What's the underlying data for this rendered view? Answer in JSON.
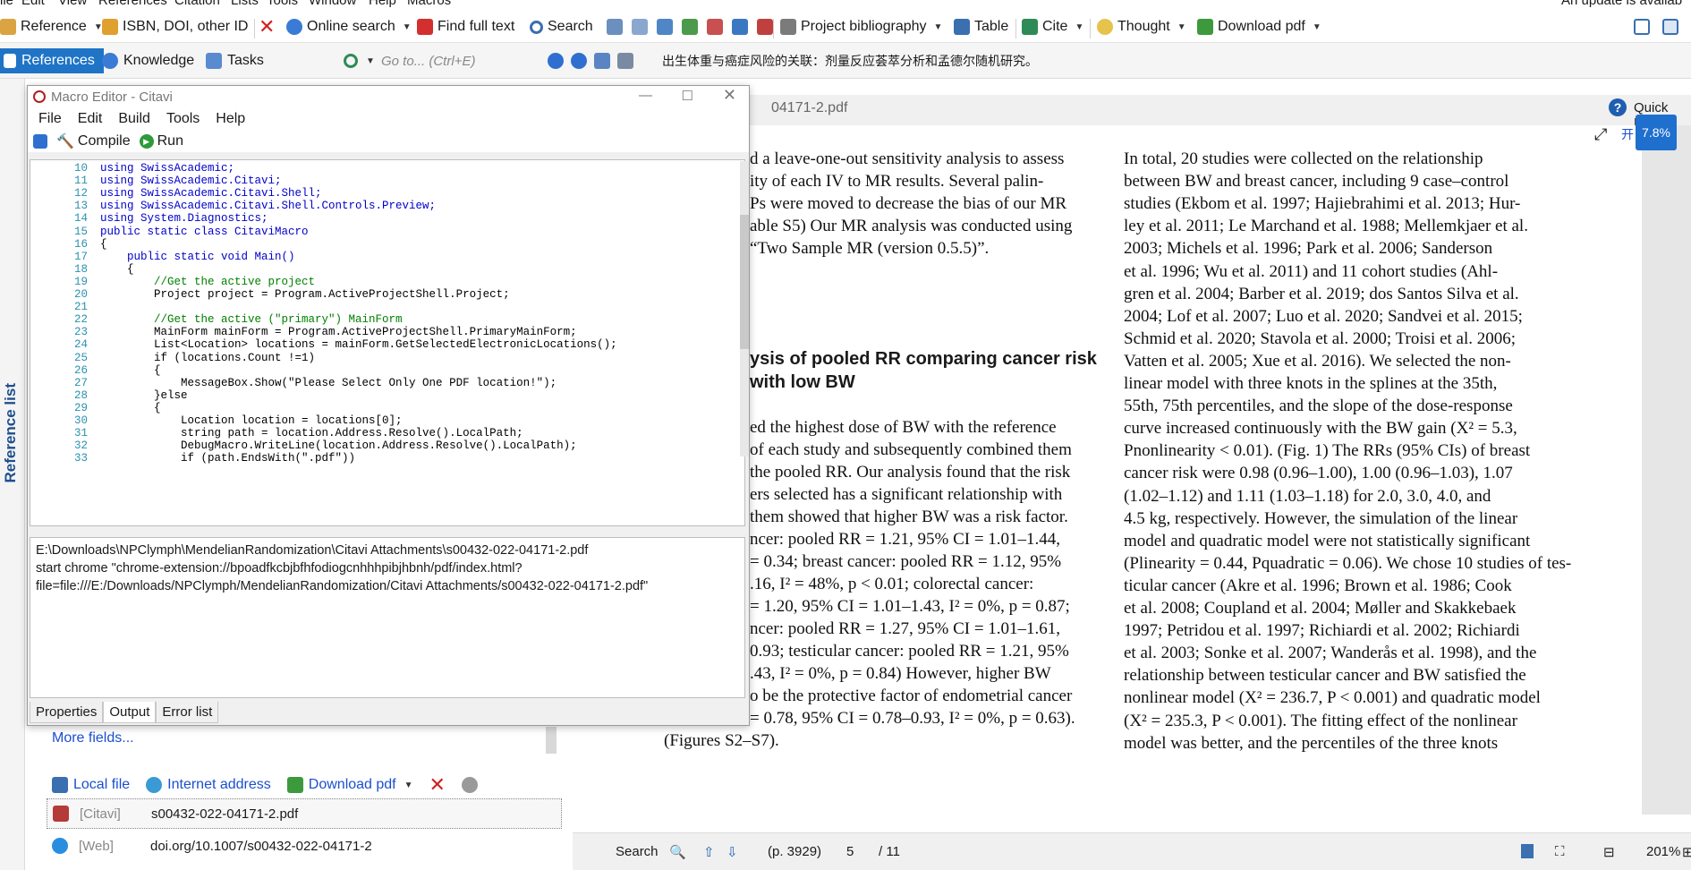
{
  "menubar": {
    "items": [
      "ile",
      "Edit",
      "View",
      "References",
      "Citation",
      "Lists",
      "Tools",
      "Window",
      "Help",
      "Macros"
    ],
    "update_text": "An update is availab"
  },
  "toolbar": {
    "reference": "Reference",
    "isbn": "ISBN, DOI, other ID",
    "online_search": "Online search",
    "find_full_text": "Find full text",
    "search": "Search",
    "project_bibliography": "Project bibliography",
    "table": "Table",
    "cite": "Cite",
    "thought": "Thought",
    "download_pdf": "Download pdf"
  },
  "nav": {
    "references": "References",
    "knowledge": "Knowledge",
    "tasks": "Tasks",
    "goto_placeholder": "Go to... (Ctrl+E)",
    "doc_title": "出生体重与癌症风险的关联：剂量反应荟萃分析和孟德尔随机研究。"
  },
  "sidebar": {
    "reference_list": "Reference list"
  },
  "macro_editor": {
    "title": "Macro Editor - Citavi",
    "menu": [
      "File",
      "Edit",
      "Build",
      "Tools",
      "Help"
    ],
    "compile": "Compile",
    "run": "Run",
    "code_lines": [
      {
        "n": "10",
        "t": "using SwissAcademic;"
      },
      {
        "n": "11",
        "t": "using SwissAcademic.Citavi;"
      },
      {
        "n": "12",
        "t": "using SwissAcademic.Citavi.Shell;"
      },
      {
        "n": "13",
        "t": "using SwissAcademic.Citavi.Shell.Controls.Preview;"
      },
      {
        "n": "14",
        "t": "using System.Diagnostics;"
      },
      {
        "n": "15",
        "t": "public static class CitaviMacro"
      },
      {
        "n": "16",
        "t": "{"
      },
      {
        "n": "17",
        "t": "    public static void Main()"
      },
      {
        "n": "18",
        "t": "    {"
      },
      {
        "n": "19",
        "t": "        //Get the active project"
      },
      {
        "n": "20",
        "t": "        Project project = Program.ActiveProjectShell.Project;"
      },
      {
        "n": "21",
        "t": ""
      },
      {
        "n": "22",
        "t": "        //Get the active (\"primary\") MainForm"
      },
      {
        "n": "23",
        "t": "        MainForm mainForm = Program.ActiveProjectShell.PrimaryMainForm;"
      },
      {
        "n": "24",
        "t": "        List<Location> locations = mainForm.GetSelectedElectronicLocations();"
      },
      {
        "n": "25",
        "t": "        if (locations.Count !=1)"
      },
      {
        "n": "26",
        "t": "        {"
      },
      {
        "n": "27",
        "t": "            MessageBox.Show(\"Please Select Only One PDF location!\");"
      },
      {
        "n": "28",
        "t": "        }else"
      },
      {
        "n": "29",
        "t": "        {"
      },
      {
        "n": "30",
        "t": "            Location location = locations[0];"
      },
      {
        "n": "31",
        "t": "            string path = location.Address.Resolve().LocalPath;"
      },
      {
        "n": "32",
        "t": "            DebugMacro.WriteLine(location.Address.Resolve().LocalPath);"
      },
      {
        "n": "33",
        "t": "            if (path.EndsWith(\".pdf\"))"
      }
    ],
    "output_lines": [
      "E:\\Downloads\\NPClymph\\MendelianRandomization\\Citavi Attachments\\s00432-022-04171-2.pdf",
      "start chrome \"chrome-extension://bpoadfkcbjbfhfodiogcnhhhpibjhbnh/pdf/index.html?",
      "file=file:///E:/Downloads/NPClymph/MendelianRandomization/Citavi Attachments/s00432-022-04171-2.pdf\""
    ],
    "tabs": [
      "Properties",
      "Output",
      "Error list"
    ]
  },
  "left_panel": {
    "more_fields": "More fields...",
    "local_file": "Local file",
    "internet_address": "Internet address",
    "download_pdf": "Download pdf",
    "files": [
      {
        "tag": "[Citavi]",
        "name": "s00432-022-04171-2.pdf"
      },
      {
        "tag": "[Web]",
        "name": "doi.org/10.1007/s00432-022-04171-2"
      }
    ]
  },
  "pdf": {
    "filename": "04171-2.pdf",
    "quick_help": "Quick Hel",
    "zoom_badge": "7.8%",
    "open_label": "开",
    "left_top": [
      "d a leave-one-out sensitivity analysis to assess",
      "ity of each IV to MR results. Several palin-",
      "Ps were moved to decrease the bias of our MR",
      "able S5) Our MR analysis was conducted using",
      "“Two Sample MR (version 0.5.5)”."
    ],
    "heading": [
      "ysis of pooled RR comparing cancer risk",
      " with low BW"
    ],
    "left_bottom": [
      "ed the highest dose of BW with the reference",
      "of each study and subsequently combined them",
      "the pooled RR. Our analysis found that the risk",
      "ers selected has a significant relationship with",
      "them showed that higher BW was a risk factor.",
      "ncer: pooled RR = 1.21, 95% CI = 1.01–1.44,",
      "= 0.34; breast cancer: pooled RR = 1.12, 95%",
      ".16, I² = 48%, p < 0.01; colorectal cancer:",
      "= 1.20, 95% CI = 1.01–1.43, I² = 0%, p = 0.87;",
      "ncer: pooled RR = 1.27, 95% CI = 1.01–1.61,",
      "0.93; testicular cancer: pooled RR = 1.21, 95%",
      ".43, I² = 0%, p = 0.84) However, higher BW",
      "o be the protective factor of endometrial cancer",
      "= 0.78, 95% CI = 0.78–0.93, I² = 0%, p = 0.63).",
      "(Figures S2–S7)."
    ],
    "right_col": [
      "In total, 20 studies were collected on the relationship",
      "between BW and breast cancer, including 9 case–control",
      "studies (Ekbom et al. 1997; Hajiebrahimi et al. 2013; Hur-",
      "ley et al. 2011; Le Marchand et al. 1988; Mellemkjaer et al.",
      "2003; Michels et al. 1996; Park et al. 2006; Sanderson",
      "et al. 1996; Wu et al. 2011) and 11 cohort studies (Ahl-",
      "gren et al. 2004; Barber et al. 2019; dos Santos Silva et al.",
      "2004; Lof et al. 2007; Luo et al. 2020; Sandvei et al. 2015;",
      "Schmid et al. 2020; Stavola et al. 2000; Troisi et al. 2006;",
      "Vatten et al. 2005; Xue et al. 2016). We selected the non-",
      "linear model with three knots in the splines at the 35th,",
      "55th, 75th percentiles, and the slope of the dose-response",
      "curve increased continuously with the BW gain (X² = 5.3,",
      "Pnonlinearity < 0.01). (Fig. 1) The RRs (95% CIs) of breast",
      "cancer risk were 0.98 (0.96–1.00), 1.00 (0.96–1.03), 1.07",
      "(1.02–1.12) and 1.11 (1.03–1.18) for 2.0, 3.0, 4.0, and",
      "4.5 kg, respectively. However, the simulation of the linear",
      "model and quadratic model were not statistically significant",
      "(Plinearity = 0.44, Pquadratic = 0.06). We chose 10 studies of tes-",
      "ticular cancer (Akre et al. 1996; Brown et al. 1986; Cook",
      "et al. 2008; Coupland et al. 2004; Møller and Skakkebaek",
      "1997; Petridou et al. 1997; Richiardi et al. 2002; Richiardi",
      "et al. 2003; Sonke et al. 2007; Wanderås et al. 1998), and the",
      "relationship between testicular cancer and BW satisfied the",
      "nonlinear model (X² = 236.7, P < 0.001) and quadratic model",
      "(X² = 235.3, P < 0.001). The fitting effect of the nonlinear",
      "model was better, and the percentiles of the three knots"
    ]
  },
  "status": {
    "search": "Search",
    "page_label": "(p. 3929)",
    "page_current": "5",
    "page_total": "/ 11",
    "zoom": "201%"
  }
}
